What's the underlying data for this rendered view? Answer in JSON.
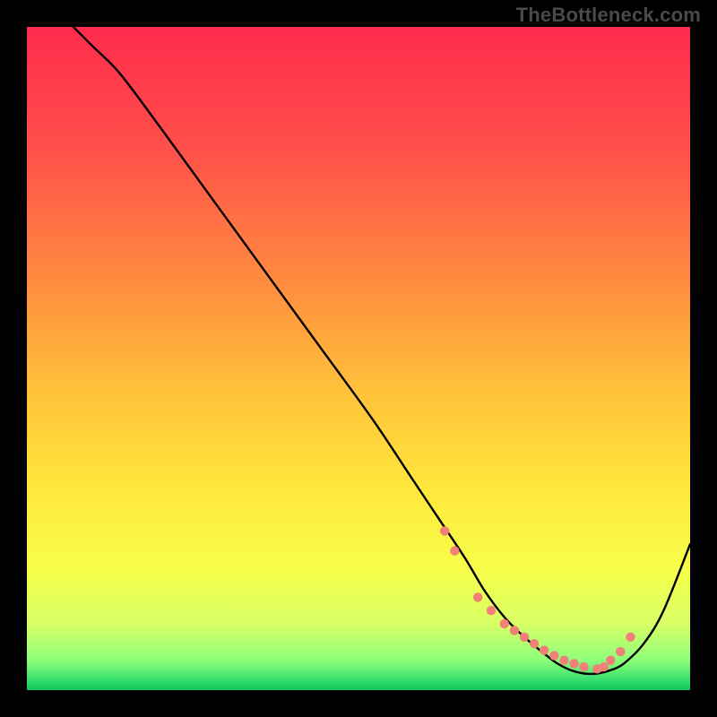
{
  "watermark": "TheBottleneck.com",
  "chart_data": {
    "type": "line",
    "title": "",
    "xlabel": "",
    "ylabel": "",
    "xlim": [
      0,
      100
    ],
    "ylim": [
      0,
      100
    ],
    "gradient_stops": [
      {
        "offset": 0.0,
        "color": "#ff2b4d"
      },
      {
        "offset": 0.18,
        "color": "#ff4f4a"
      },
      {
        "offset": 0.38,
        "color": "#ff8a3f"
      },
      {
        "offset": 0.55,
        "color": "#ffc23a"
      },
      {
        "offset": 0.7,
        "color": "#ffe83c"
      },
      {
        "offset": 0.82,
        "color": "#f7ff4a"
      },
      {
        "offset": 0.9,
        "color": "#d7ff66"
      },
      {
        "offset": 0.955,
        "color": "#8eff7a"
      },
      {
        "offset": 0.985,
        "color": "#35e06e"
      },
      {
        "offset": 1.0,
        "color": "#11c25a"
      }
    ],
    "series": [
      {
        "name": "bottleneck-curve",
        "color": "#000000",
        "x": [
          7,
          10,
          14,
          20,
          28,
          36,
          44,
          52,
          58,
          62,
          66,
          69,
          72,
          75,
          78,
          80,
          82,
          84,
          86,
          88,
          90,
          93,
          96,
          100
        ],
        "y": [
          100,
          97,
          93,
          85,
          74,
          63,
          52,
          41,
          32,
          26,
          20,
          15,
          11,
          8,
          5.5,
          4,
          3,
          2.5,
          2.5,
          3,
          4,
          7,
          12,
          22
        ]
      }
    ],
    "markers": {
      "name": "highlight-dots",
      "color": "#f08078",
      "radius": 5.2,
      "x": [
        63,
        64.5,
        68,
        70,
        72,
        73.5,
        75,
        76.5,
        78,
        79.5,
        81,
        82.5,
        84,
        86,
        87,
        88,
        89.5,
        91
      ],
      "y": [
        24,
        21,
        14,
        12,
        10,
        9,
        8,
        7,
        6,
        5.2,
        4.5,
        4,
        3.5,
        3.2,
        3.5,
        4.5,
        5.8,
        8
      ]
    }
  }
}
